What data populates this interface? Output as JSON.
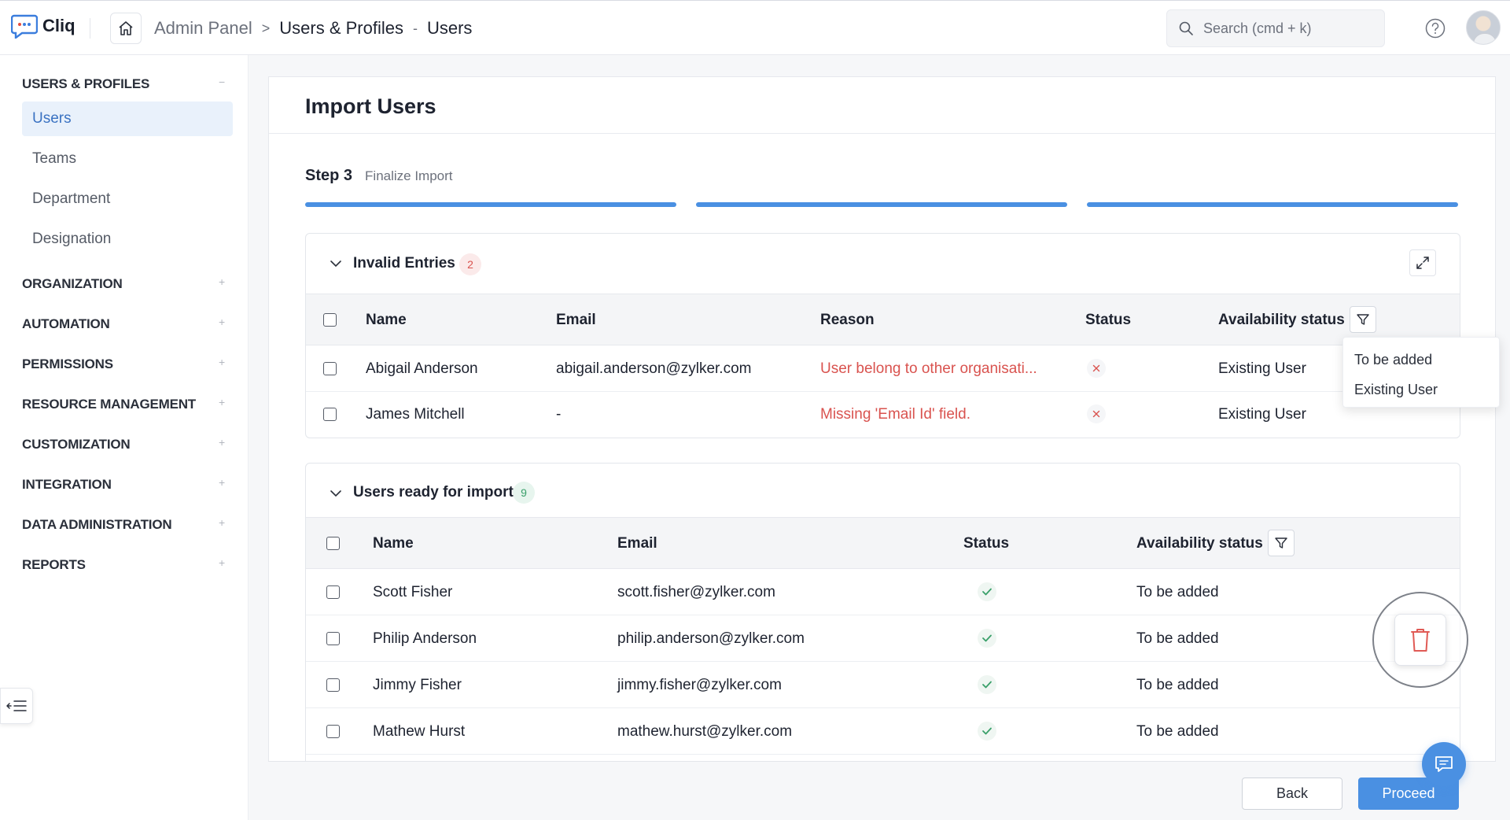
{
  "app": {
    "name": "Cliq"
  },
  "breadcrumb": {
    "root": "Admin Panel",
    "separator": ">",
    "section": "Users & Profiles",
    "dash": "-",
    "page": "Users"
  },
  "search": {
    "placeholder": "Search (cmd + k)"
  },
  "sidebar": {
    "sections": [
      {
        "label": "USERS & PROFILES",
        "toggle": "−",
        "items": [
          "Users",
          "Teams",
          "Department",
          "Designation"
        ]
      },
      {
        "label": "ORGANIZATION",
        "toggle": "+"
      },
      {
        "label": "AUTOMATION",
        "toggle": "+"
      },
      {
        "label": "PERMISSIONS",
        "toggle": "+"
      },
      {
        "label": "RESOURCE MANAGEMENT",
        "toggle": "+"
      },
      {
        "label": "CUSTOMIZATION",
        "toggle": "+"
      },
      {
        "label": "INTEGRATION",
        "toggle": "+"
      },
      {
        "label": "DATA ADMINISTRATION",
        "toggle": "+"
      },
      {
        "label": "REPORTS",
        "toggle": "+"
      }
    ]
  },
  "main": {
    "title": "Import Users",
    "step": {
      "label": "Step 3",
      "description": "Finalize Import",
      "progress_filled": 3,
      "progress_total": 3
    }
  },
  "invalid": {
    "title": "Invalid Entries",
    "count": "2",
    "columns": {
      "name": "Name",
      "email": "Email",
      "reason": "Reason",
      "status": "Status",
      "availability": "Availability status"
    },
    "rows": [
      {
        "name": "Abigail Anderson",
        "email": "abigail.anderson@zylker.com",
        "reason": "User belong to other organisati...",
        "availability": "Existing User"
      },
      {
        "name": "James Mitchell",
        "email": "-",
        "reason": "Missing 'Email Id' field.",
        "availability": "Existing User"
      }
    ]
  },
  "filter_menu": {
    "options": [
      "To be added",
      "Existing User"
    ]
  },
  "ready": {
    "title": "Users ready for import",
    "count": "9",
    "columns": {
      "name": "Name",
      "email": "Email",
      "status": "Status",
      "availability": "Availability status"
    },
    "rows": [
      {
        "name": "Scott Fisher",
        "email": "scott.fisher@zylker.com",
        "availability": "To be added"
      },
      {
        "name": "Philip Anderson",
        "email": "philip.anderson@zylker.com",
        "availability": "To be added"
      },
      {
        "name": "Jimmy Fisher",
        "email": "jimmy.fisher@zylker.com",
        "availability": "To be added"
      },
      {
        "name": "Mathew Hurst",
        "email": "mathew.hurst@zylker.com",
        "availability": "To be added"
      }
    ]
  },
  "footer": {
    "back_label": "Back",
    "proceed_label": "Proceed"
  },
  "colors": {
    "accent": "#4a90e2",
    "error": "#d9534f",
    "success": "#3aa06a",
    "active_bg": "#e9f1fb"
  }
}
